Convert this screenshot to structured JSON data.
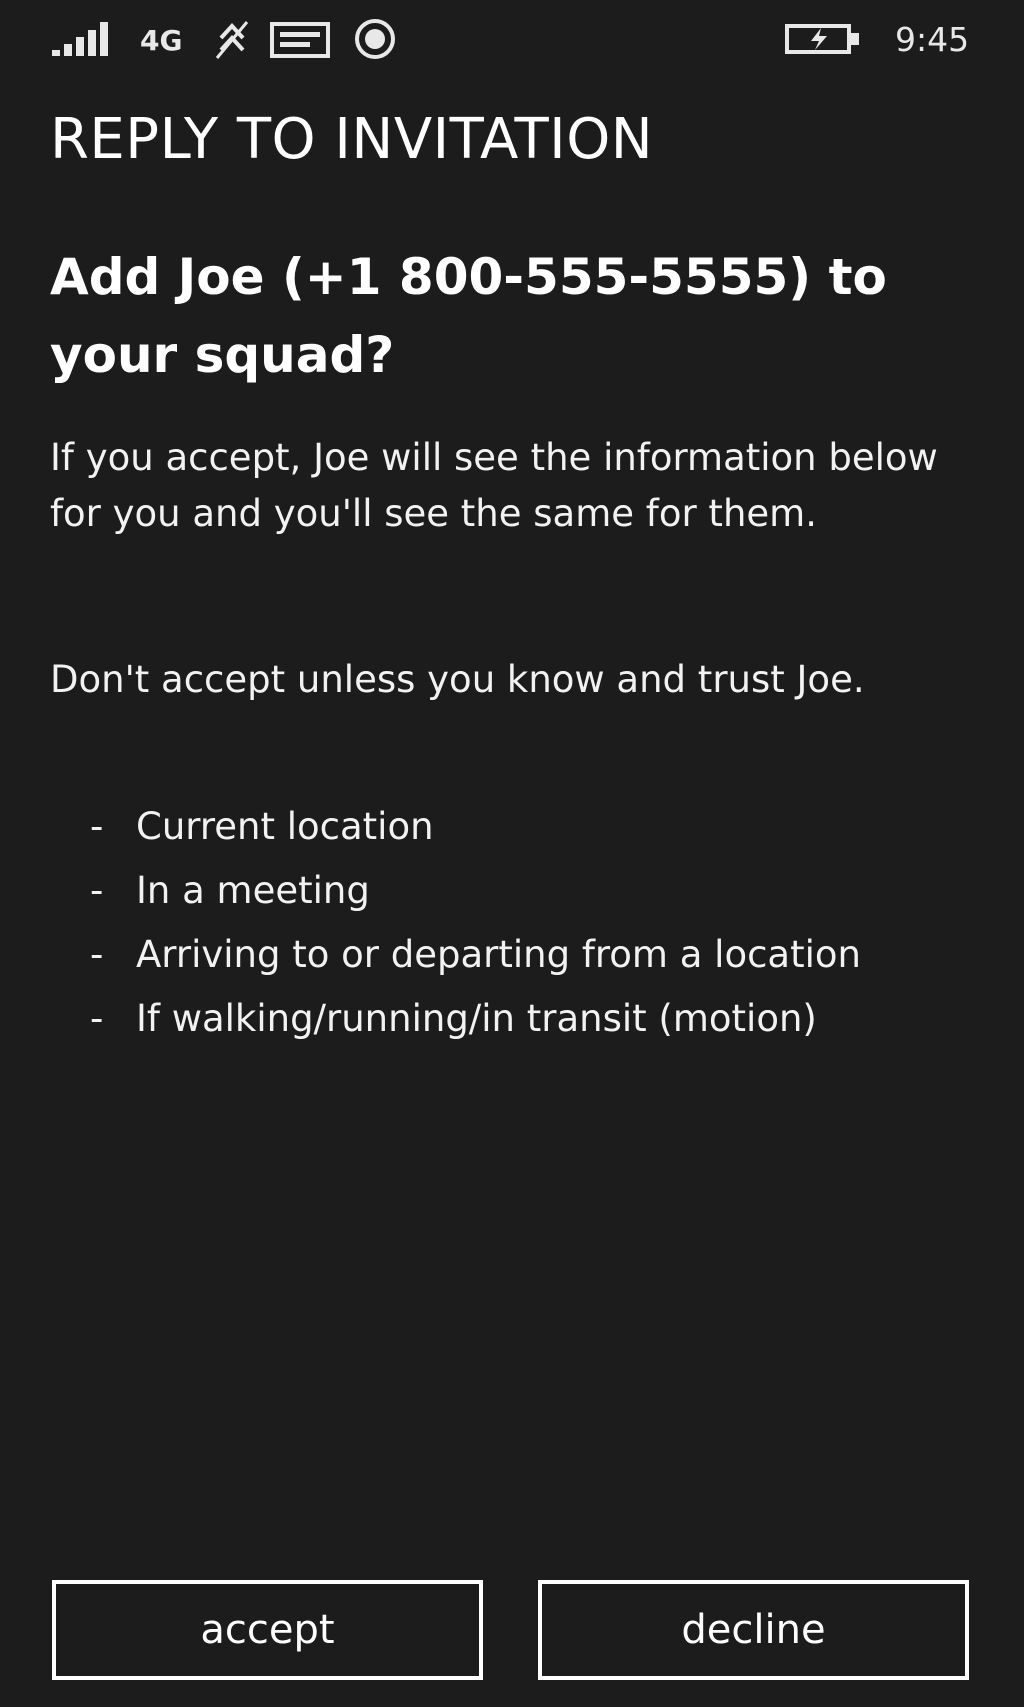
{
  "status_bar": {
    "signal_icon": "signal-strength-icon",
    "network": "4G",
    "sync_icon": "sync-icon",
    "message_icon": "message-icon",
    "record_icon": "record-icon",
    "battery_icon": "battery-charging-icon",
    "time": "9:45"
  },
  "page": {
    "title": "REPLY TO INVITATION",
    "question": "Add Joe (+1 800-555-5555) to your squad?",
    "paragraphs": [
      "If you accept, Joe will see the information below for you and you'll see the same for them.",
      "Don't accept unless you know and trust Joe."
    ],
    "list_marker": "-",
    "shared_items": [
      "Current location",
      "In a meeting",
      "Arriving to or departing from a location",
      "If walking/running/in transit (motion)"
    ]
  },
  "actions": {
    "accept_label": "accept",
    "decline_label": "decline"
  },
  "colors": {
    "background": "#1c1c1c",
    "text": "#ffffff"
  }
}
